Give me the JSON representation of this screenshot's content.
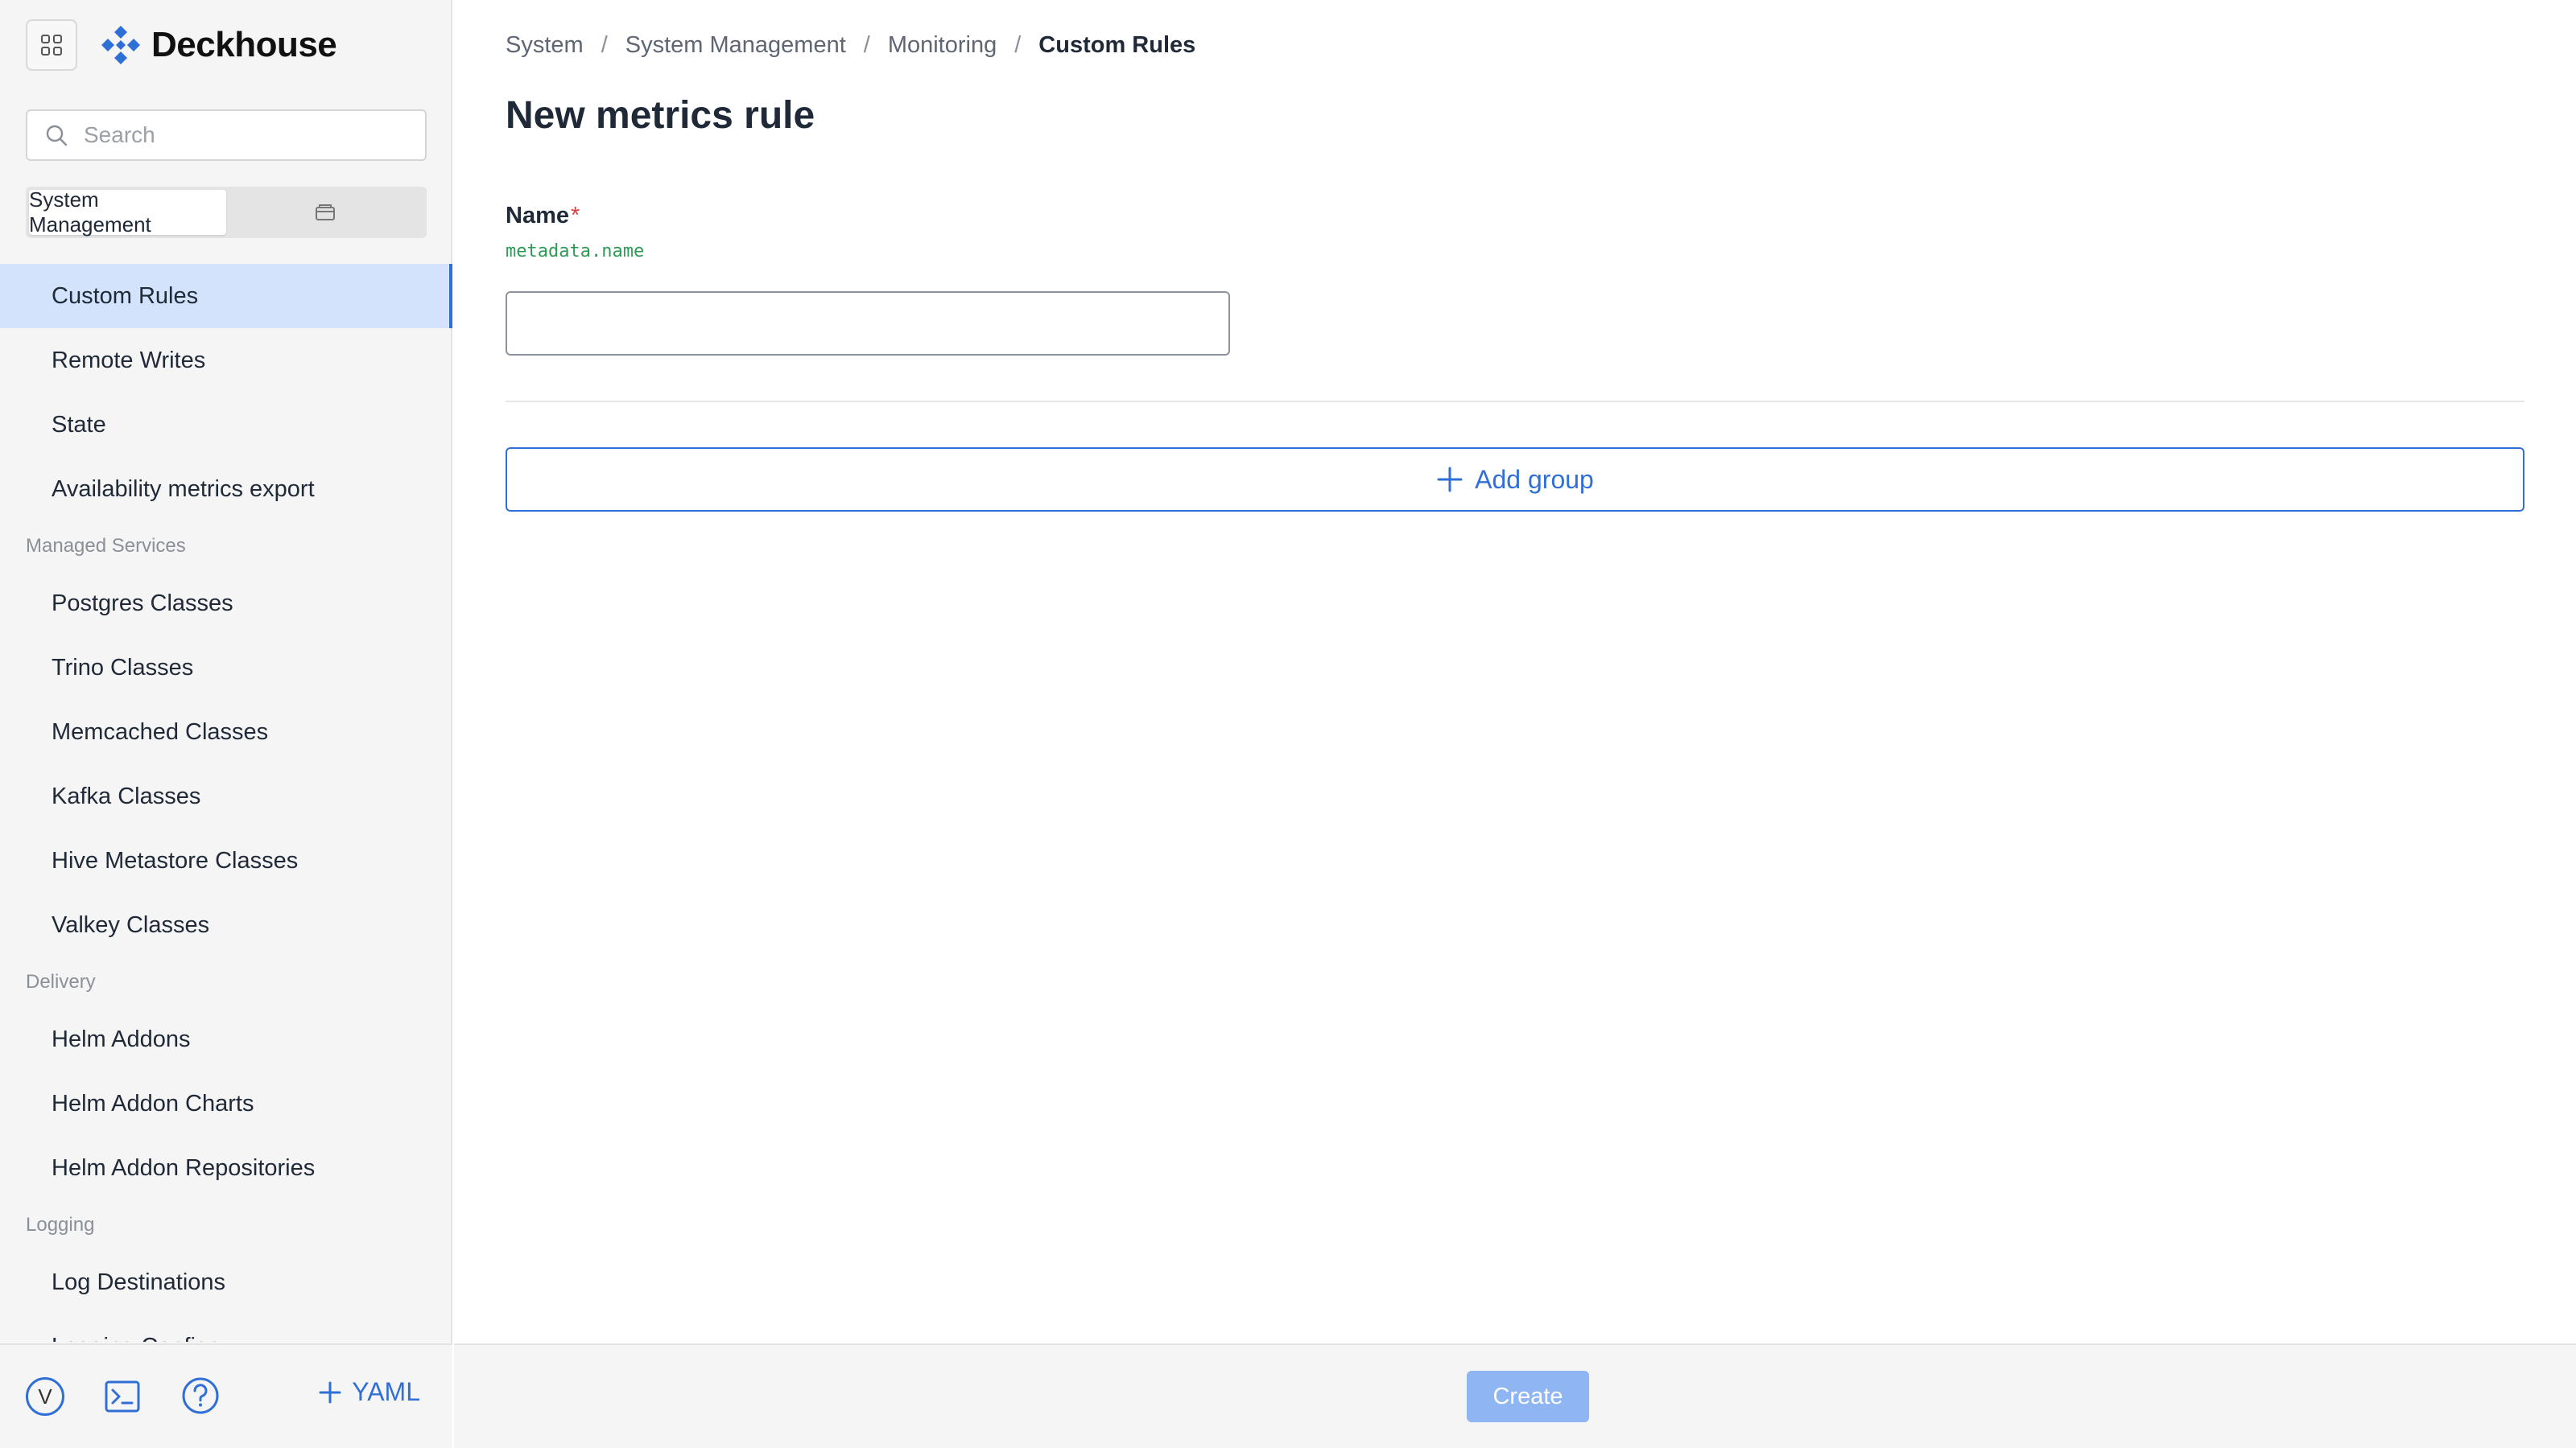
{
  "app": {
    "name": "Deckhouse",
    "brand_color": "#2f6fd6",
    "icons": {
      "apps": "grid-icon",
      "logo": "deckhouse-logo-icon",
      "search": "search-icon",
      "namespace": "folder-icon",
      "terminal": "terminal-icon",
      "help": "help-icon",
      "add": "plus-icon"
    }
  },
  "sidebar": {
    "search": {
      "placeholder": "Search",
      "value": ""
    },
    "scope": {
      "active": "System Management",
      "inactive_icon": "folder-icon"
    },
    "items": [
      {
        "label": "Custom Rules",
        "active": true
      },
      {
        "label": "Remote Writes"
      },
      {
        "label": "State"
      },
      {
        "label": "Availability metrics export"
      }
    ],
    "sections": [
      {
        "title": "Managed Services",
        "items": [
          "Postgres Classes",
          "Trino Classes",
          "Memcached Classes",
          "Kafka Classes",
          "Hive Metastore Classes",
          "Valkey Classes"
        ]
      },
      {
        "title": "Delivery",
        "items": [
          "Helm Addons",
          "Helm Addon Charts",
          "Helm Addon Repositories"
        ]
      },
      {
        "title": "Logging",
        "items": [
          "Log Destinations",
          "Logging Configs"
        ]
      }
    ],
    "footer": {
      "avatar_initial": "V",
      "yaml_label": "YAML"
    }
  },
  "main": {
    "breadcrumb": [
      "System",
      "System Management",
      "Monitoring",
      "Custom Rules"
    ],
    "title": "New metrics rule",
    "name_field": {
      "label": "Name",
      "required_mark": "*",
      "path": "metadata.name",
      "value": ""
    },
    "add_group_label": "Add group",
    "create_label": "Create"
  }
}
